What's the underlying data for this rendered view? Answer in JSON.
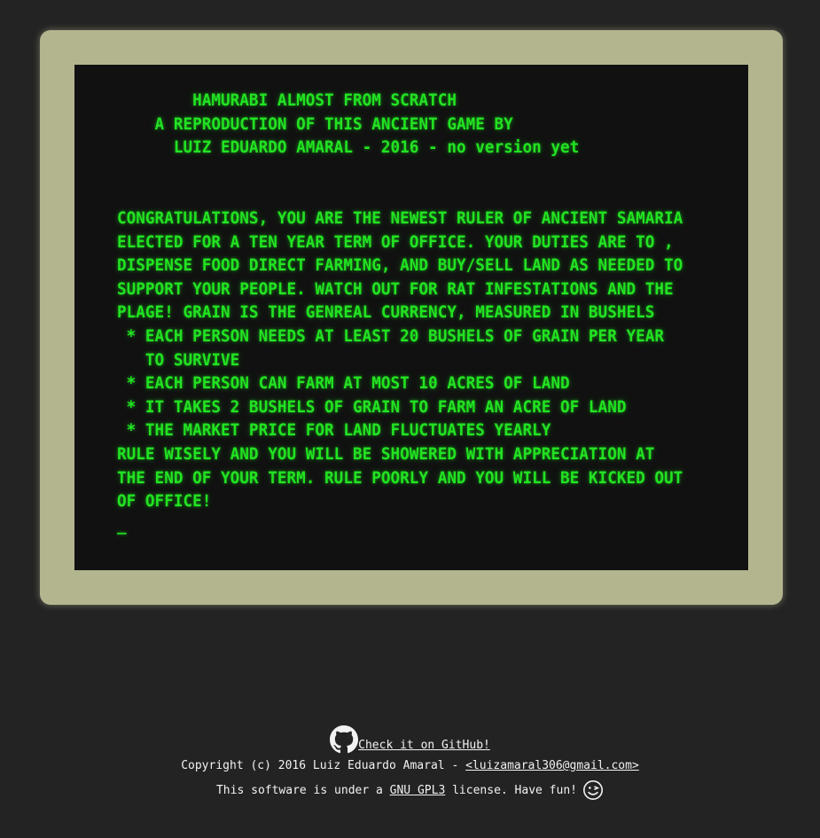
{
  "terminal": {
    "text": "        HAMURABI ALMOST FROM SCRATCH\n    A REPRODUCTION OF THIS ANCIENT GAME BY\n      LUIZ EDUARDO AMARAL - 2016 - no version yet\n\n\nCONGRATULATIONS, YOU ARE THE NEWEST RULER OF ANCIENT SAMARIA\nELECTED FOR A TEN YEAR TERM OF OFFICE. YOUR DUTIES ARE TO ,\nDISPENSE FOOD DIRECT FARMING, AND BUY/SELL LAND AS NEEDED TO\nSUPPORT YOUR PEOPLE. WATCH OUT FOR RAT INFESTATIONS AND THE\nPLAGE! GRAIN IS THE GENREAL CURRENCY, MEASURED IN BUSHELS\n * EACH PERSON NEEDS AT LEAST 20 BUSHELS OF GRAIN PER YEAR\n   TO SURVIVE\n * EACH PERSON CAN FARM AT MOST 10 ACRES OF LAND\n * IT TAKES 2 BUSHELS OF GRAIN TO FARM AN ACRE OF LAND\n * THE MARKET PRICE FOR LAND FLUCTUATES YEARLY\nRULE WISELY AND YOU WILL BE SHOWERED WITH APPRECIATION AT\nTHE END OF YOUR TERM. RULE POORLY AND YOU WILL BE KICKED OUT\nOF OFFICE!\n",
    "cursor": "_",
    "color": "#22e322"
  },
  "footer": {
    "github_icon": "github-icon",
    "github_link": "Check it on GitHub!",
    "copyright": "Copyright (c) 2016 Luiz Eduardo Amaral - ",
    "email": "<luizamaral306@gmail.com>",
    "license_prefix": "This software is under a ",
    "license_link": "GNU GPL3",
    "license_suffix": " license. Have fun!",
    "wink_icon": "winking-face-icon"
  },
  "colors": {
    "background": "#232323",
    "monitor_bezel": "#b3b58e",
    "screen": "#111111",
    "footer_text": "#f2f2f2"
  }
}
